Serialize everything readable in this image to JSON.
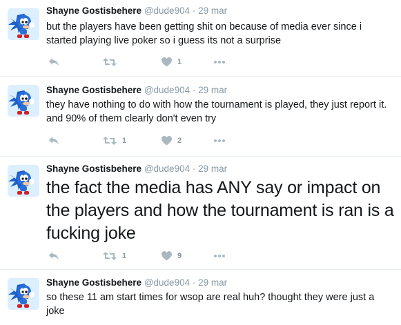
{
  "user": {
    "name": "Shayne Gostisbehere",
    "handle": "@dude904",
    "separator": "·"
  },
  "tweets": [
    {
      "time": "29 mar",
      "text": "but the players have been getting shit on because of media ever since i started playing live poker so i guess its not a surprise",
      "retweets": "",
      "likes": "1"
    },
    {
      "time": "29 mar",
      "text": "they have nothing to do with how the tournament is played, they just report it. and 90% of them clearly don't even try",
      "retweets": "1",
      "likes": "2"
    },
    {
      "time": "29 mar",
      "text": "the fact the media has ANY say or impact on the players and how the tournament is ran is a fucking joke",
      "retweets": "1",
      "likes": "9"
    },
    {
      "time": "29 mar",
      "text": "so these 11 am start times for wsop are real huh? thought they were just a joke",
      "retweets": "",
      "likes": ""
    }
  ],
  "icons": {
    "reply": "reply-icon",
    "retweet": "retweet-icon",
    "like": "heart-icon",
    "more": "more-icon"
  },
  "colors": {
    "icon": "#aab8c2",
    "secondary_text": "#8899a6",
    "divider": "#e6ecf0"
  }
}
